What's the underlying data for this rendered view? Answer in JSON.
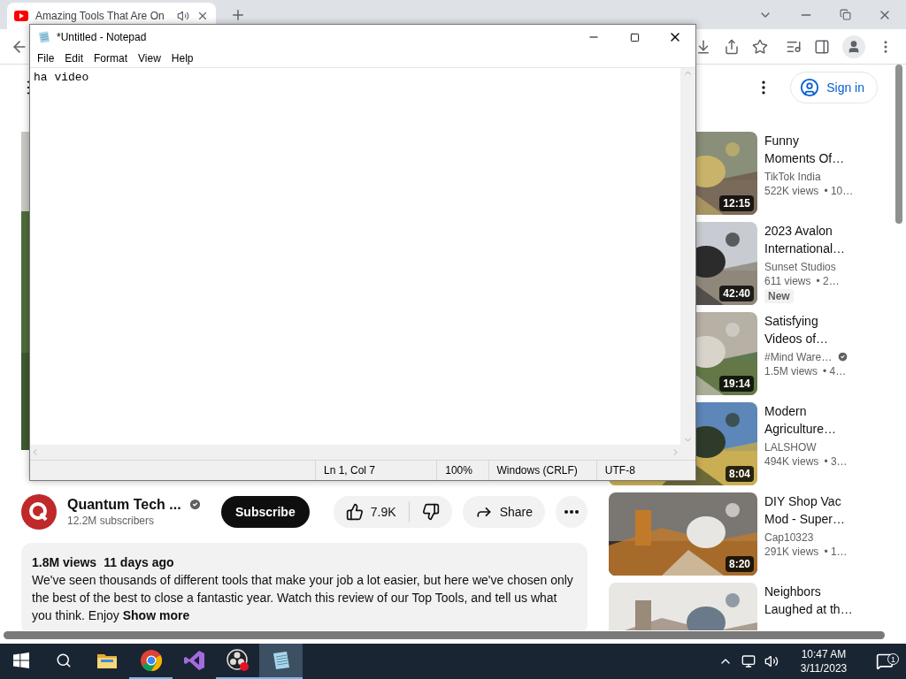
{
  "browser": {
    "tab": {
      "title": "Amazing Tools That Are On",
      "selected": true,
      "playing_audio": true
    }
  },
  "youtube": {
    "sign_in": "Sign in",
    "channel": {
      "name": "Quantum Tech ...",
      "verified": true,
      "subscribers": "12.2M subscribers"
    },
    "subscribe": "Subscribe",
    "likes": "7.9K",
    "share": "Share",
    "description": {
      "views": "1.8M views",
      "age": "11 days ago",
      "text": "We've seen thousands of different tools that make your job a lot easier, but here we've chosen only the best of the best to close a fantastic year. Watch this review of our Top Tools, and tell us what you think. Enjoy",
      "more": "Show more"
    },
    "recommendations": [
      {
        "title_lines": [
          "Funny",
          "Moments Of…"
        ],
        "channel": "TikTok India",
        "verified": false,
        "views": "522K views",
        "age": "• 10…",
        "duration": "12:15"
      },
      {
        "title_lines": [
          "2023 Avalon",
          "International…"
        ],
        "channel": "Sunset Studios",
        "verified": false,
        "views": "611 views",
        "age": "• 2…",
        "duration": "42:40",
        "badge": "New"
      },
      {
        "title_lines": [
          "Satisfying",
          "Videos of…"
        ],
        "channel": "#Mind Ware…",
        "verified": true,
        "views": "1.5M views",
        "age": "• 4…",
        "duration": "19:14"
      },
      {
        "title_lines": [
          "Modern",
          "Agriculture…"
        ],
        "channel": "LALSHOW",
        "verified": false,
        "views": "494K views",
        "age": "• 3…",
        "duration": "8:04"
      },
      {
        "title_lines": [
          "DIY Shop Vac",
          "Mod - Super…"
        ],
        "channel": "Cap10323",
        "verified": false,
        "views": "291K views",
        "age": "• 1…",
        "duration": "8:20"
      },
      {
        "title_lines": [
          "Neighbors",
          "Laughed at th…"
        ]
      }
    ]
  },
  "notepad": {
    "title": "*Untitled - Notepad",
    "menu": [
      "File",
      "Edit",
      "Format",
      "View",
      "Help"
    ],
    "text": "ha video",
    "status": [
      "Ln 1, Col 7",
      "100%",
      "Windows (CRLF)",
      "UTF-8"
    ]
  },
  "taskbar": {
    "apps": [
      {
        "kind": "explorer",
        "running": false,
        "active": false
      },
      {
        "kind": "chrome",
        "running": true,
        "active": false
      },
      {
        "kind": "studio",
        "running": false,
        "active": false
      },
      {
        "kind": "obs",
        "running": true,
        "active": false
      },
      {
        "kind": "notepad",
        "running": true,
        "active": true
      }
    ],
    "time": "10:47 AM",
    "date": "3/11/2023",
    "notifications": "1"
  }
}
